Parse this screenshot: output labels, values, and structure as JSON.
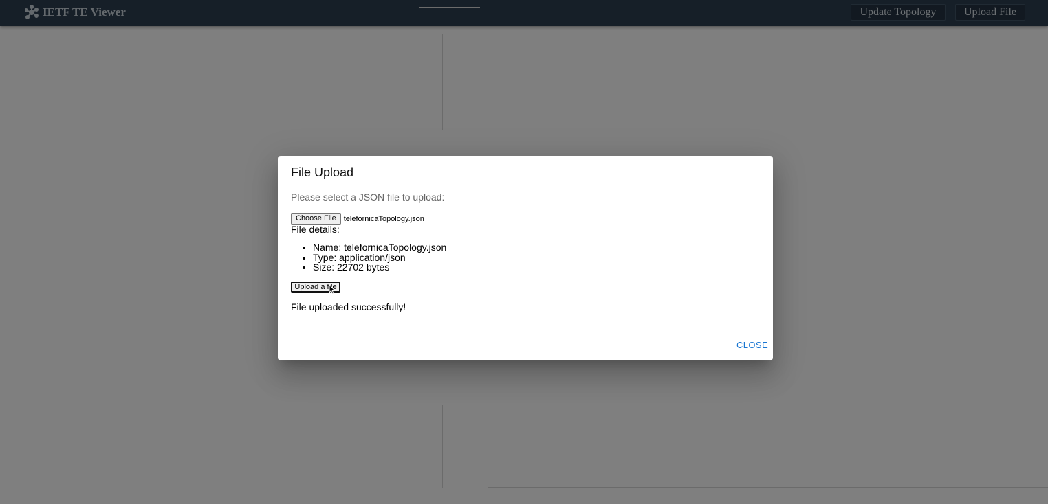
{
  "app": {
    "title": "IETF TE Viewer",
    "logo_icon": "network-nodes-icon"
  },
  "header": {
    "update_label": "Update Topology",
    "upload_label": "Upload File"
  },
  "dialog": {
    "title": "File Upload",
    "prompt": "Please select a JSON file to upload:",
    "choose_label": "Choose File",
    "chosen_filename": "telefornicaTopology.json",
    "details_label": "File details:",
    "details": [
      "Name: telefornicaTopology.json",
      "Type: application/json",
      "Size: 22702 bytes"
    ],
    "upload_label": "Upload a file",
    "status": "File uploaded successfully!",
    "close_label": "CLOSE"
  },
  "colors": {
    "header_bg": "#2c3e50",
    "accent": "#1976d2",
    "backdrop": "rgba(0,0,0,0.5)"
  }
}
